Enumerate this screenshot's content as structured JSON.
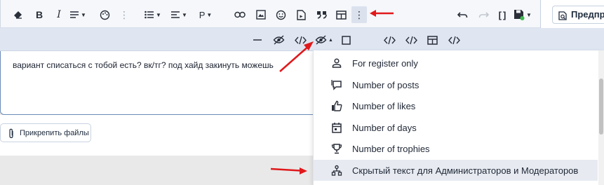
{
  "toolbar": {
    "heading_label": "P",
    "preview_label": "Предпро",
    "more_label": "⋮"
  },
  "content": {
    "text": "вариант списаться с тобой есть? вк/тг? под хайд закинуть можешь"
  },
  "attach": {
    "label": "Прикрепить файлы"
  },
  "dropdown": {
    "items": [
      {
        "label": "For register only",
        "icon": "user-icon"
      },
      {
        "label": "Number of posts",
        "icon": "posts-icon"
      },
      {
        "label": "Number of likes",
        "icon": "like-icon"
      },
      {
        "label": "Number of days",
        "icon": "calendar-icon"
      },
      {
        "label": "Number of trophies",
        "icon": "trophy-icon"
      },
      {
        "label": "Скрытый текст для Администраторов и Модераторов",
        "icon": "moderator-icon",
        "highlighted": true
      }
    ]
  },
  "colors": {
    "arrow": "#e0191b",
    "save_indicator": "#3dba4e"
  }
}
